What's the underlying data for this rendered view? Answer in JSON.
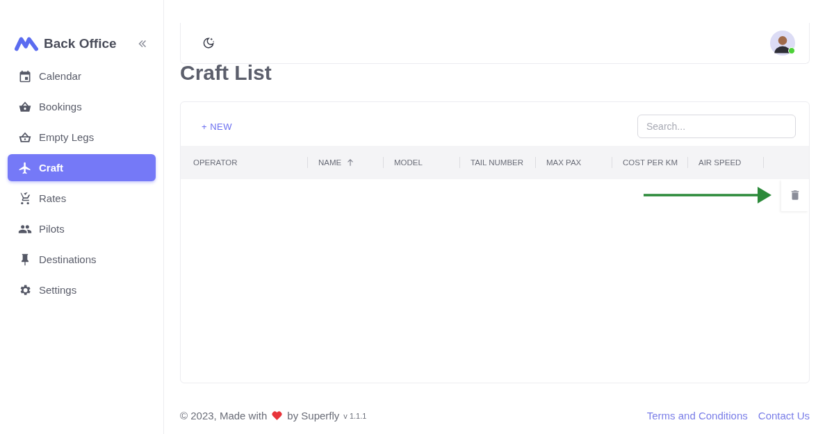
{
  "sidebar": {
    "brand": "Back Office",
    "items": [
      {
        "label": "Calendar",
        "selected": false
      },
      {
        "label": "Bookings",
        "selected": false
      },
      {
        "label": "Empty Legs",
        "selected": false
      },
      {
        "label": "Craft",
        "selected": true
      },
      {
        "label": "Rates",
        "selected": false
      },
      {
        "label": "Pilots",
        "selected": false
      },
      {
        "label": "Destinations",
        "selected": false
      },
      {
        "label": "Settings",
        "selected": false
      }
    ]
  },
  "header": {
    "online": true
  },
  "page_title": "Craft List",
  "toolbar": {
    "new_button": "+ NEW",
    "search": {
      "placeholder": "Search..."
    }
  },
  "table": {
    "columns": [
      {
        "label": "OPERATOR",
        "sorted": false
      },
      {
        "label": "NAME",
        "sorted": true
      },
      {
        "label": "MODEL",
        "sorted": false
      },
      {
        "label": "TAIL NUMBER",
        "sorted": false
      },
      {
        "label": "MAX PAX",
        "sorted": false
      },
      {
        "label": "COST PER KM",
        "sorted": false
      },
      {
        "label": "AIR SPEED",
        "sorted": false
      }
    ]
  },
  "footer": {
    "copyright": "© 2023, Made with",
    "by": "by Superfly",
    "version": "v 1.1.1",
    "links": [
      "Terms and Conditions",
      "Contact Us"
    ]
  }
}
